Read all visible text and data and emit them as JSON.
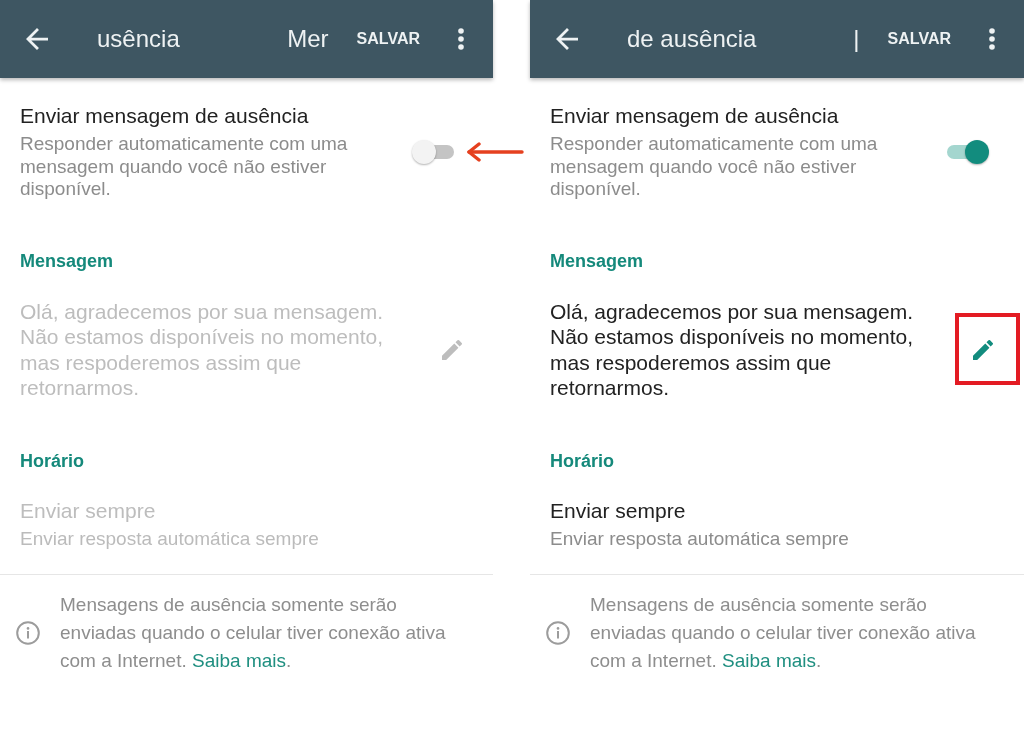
{
  "screens": [
    {
      "app_bar": {
        "title_parts": [
          "usência",
          "Mer"
        ],
        "action": "SALVAR"
      },
      "auto_reply": {
        "title": "Enviar mensagem de ausência",
        "subtitle": "Responder automaticamente com uma mensagem quando você não estiver disponível.",
        "on": false,
        "pointed_at": true
      },
      "message": {
        "heading": "Mensagem",
        "text": "Olá, agradecemos por sua mensagem. Não estamos disponíveis no momento, mas respoderemos assim que retornarmos.",
        "disabled": true,
        "highlighted": false
      },
      "schedule": {
        "heading": "Horário",
        "title": "Enviar sempre",
        "subtitle": "Enviar resposta automática sempre",
        "disabled": true
      },
      "note": {
        "text": "Mensagens de ausência somente serão enviadas quando o celular tiver conexão ativa com a Internet.",
        "link": "Saiba mais",
        "after_link": "."
      }
    },
    {
      "app_bar": {
        "title_parts": [
          "de ausência",
          "|"
        ],
        "action": "SALVAR"
      },
      "auto_reply": {
        "title": "Enviar mensagem de ausência",
        "subtitle": "Responder automaticamente com uma mensagem quando você não estiver disponível.",
        "on": true,
        "pointed_at": false
      },
      "message": {
        "heading": "Mensagem",
        "text": "Olá, agradecemos por sua mensagem. Não estamos disponíveis no momento, mas respoderemos assim que retornarmos.",
        "disabled": false,
        "highlighted": true
      },
      "schedule": {
        "heading": "Horário",
        "title": "Enviar sempre",
        "subtitle": "Enviar resposta automática sempre",
        "disabled": false
      },
      "note": {
        "text": "Mensagens de ausência somente serão enviadas quando o celular tiver conexão ativa com a Internet.",
        "link": "Saiba mais",
        "after_link": "."
      }
    }
  ]
}
